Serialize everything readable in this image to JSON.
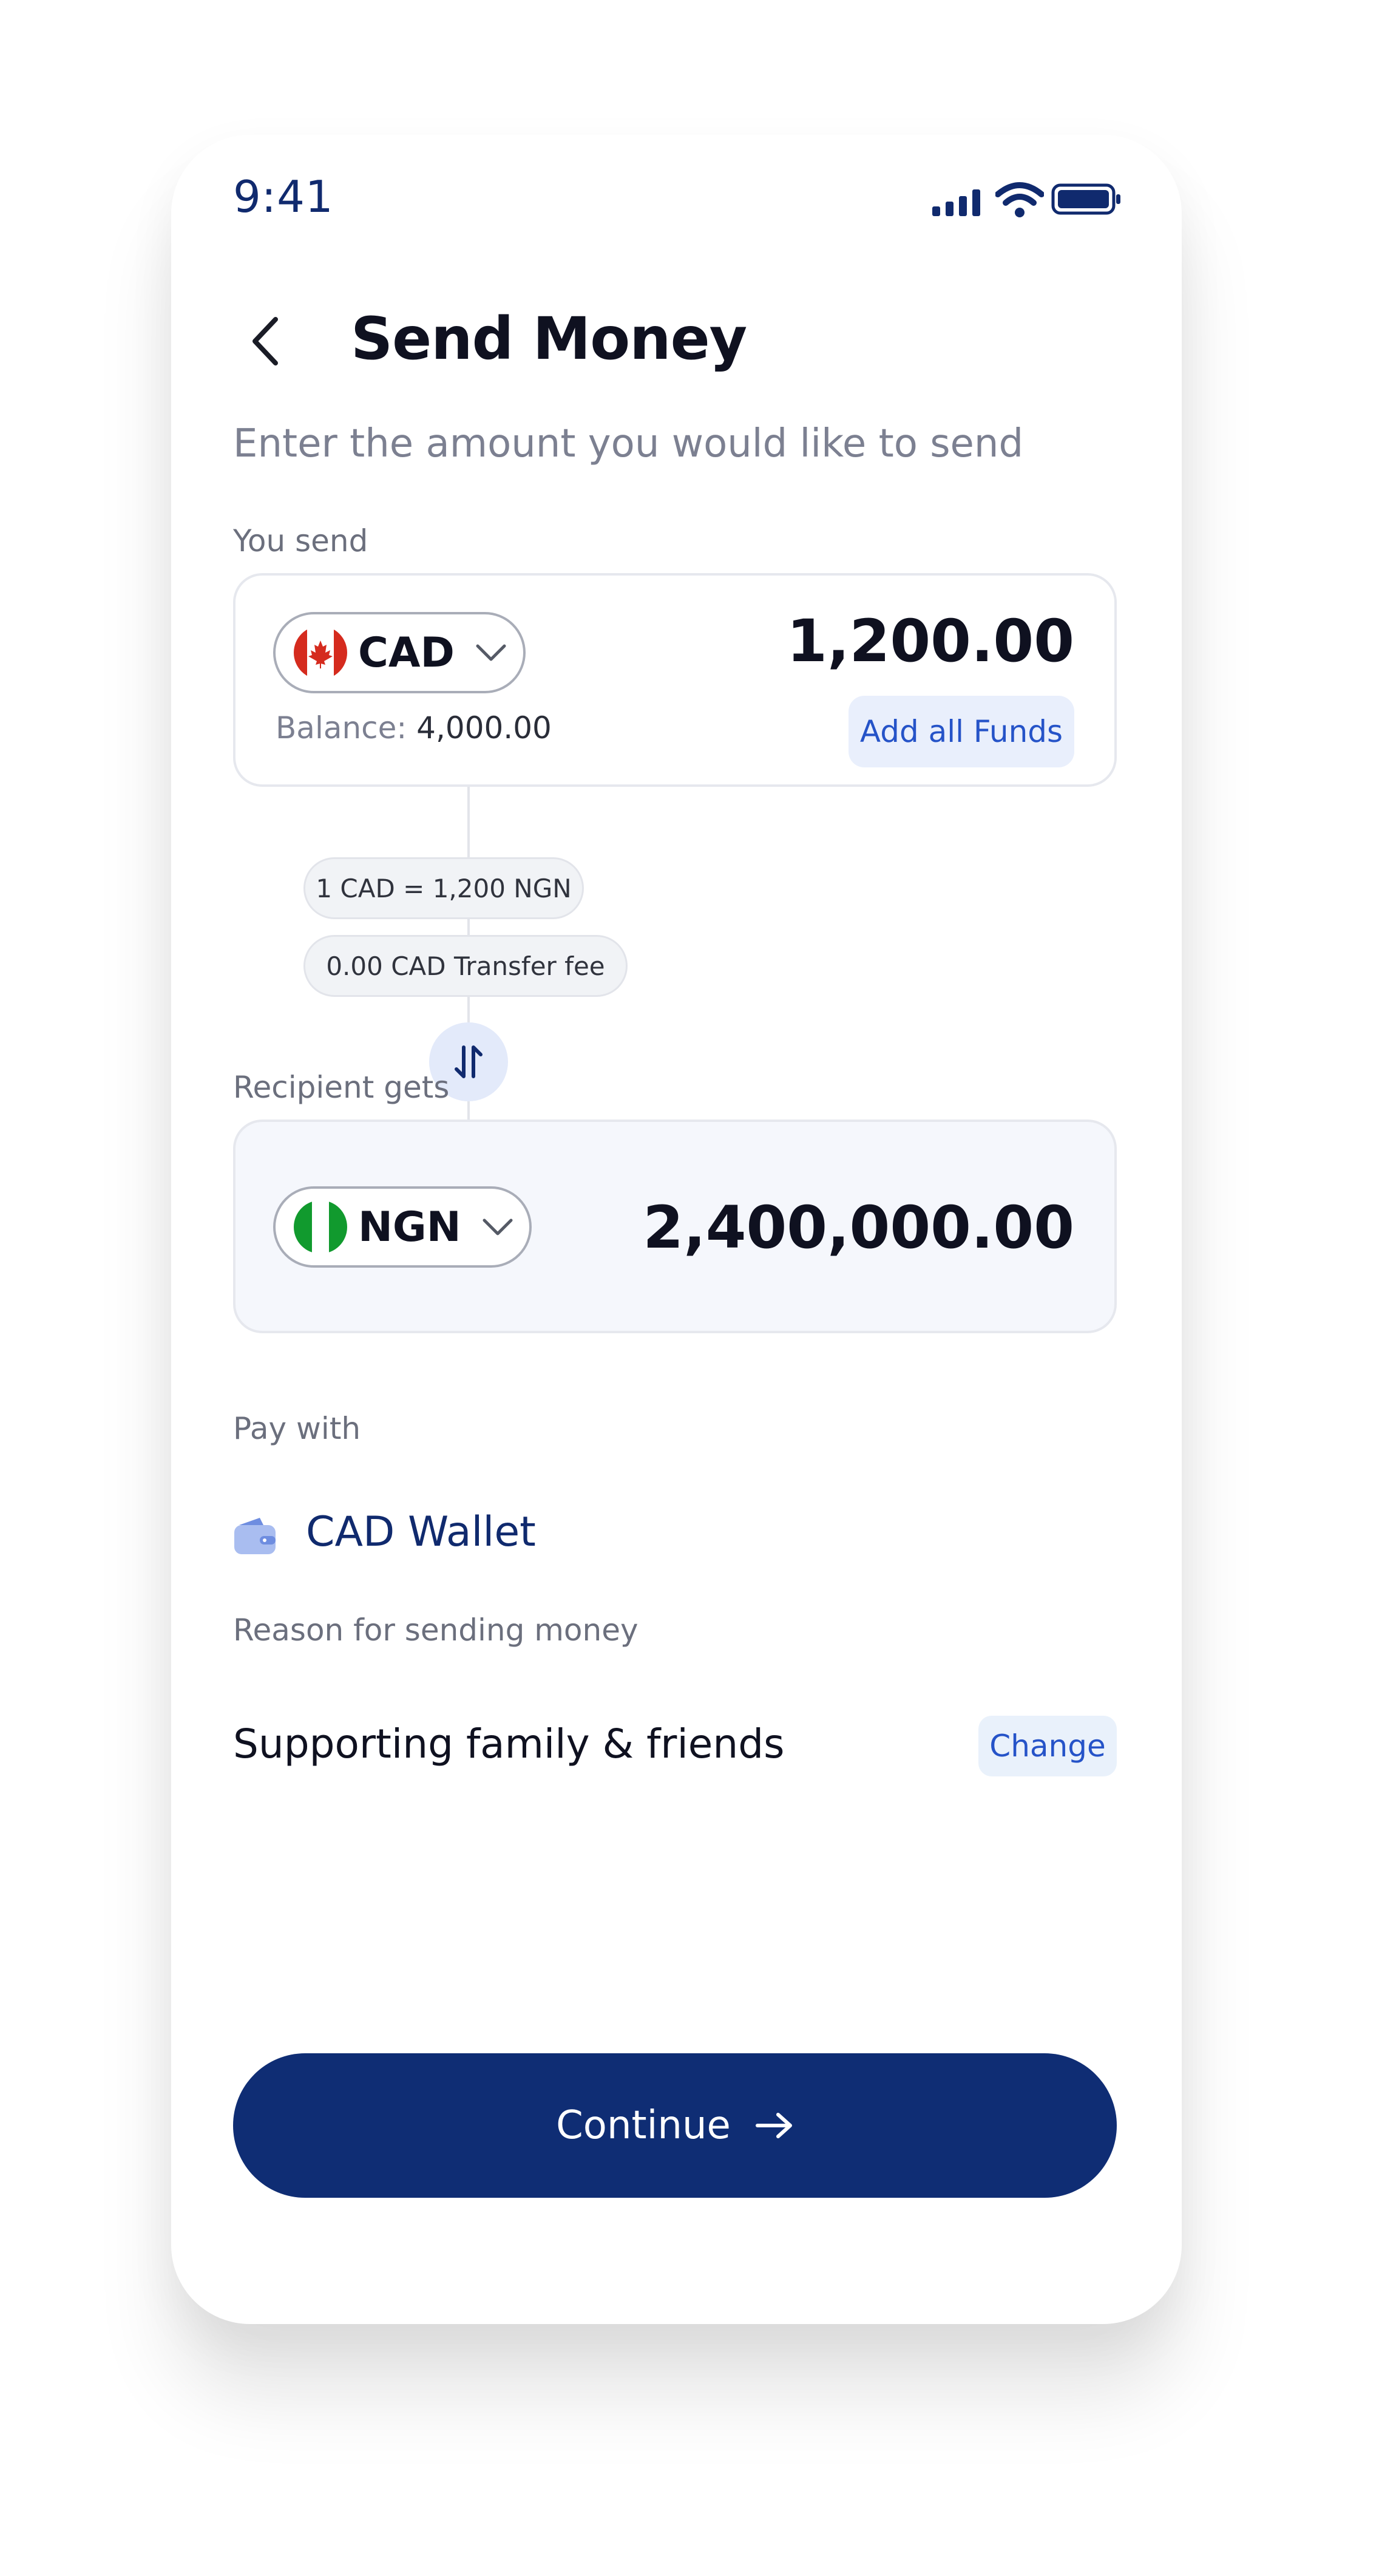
{
  "status_bar": {
    "time": "9:41"
  },
  "header": {
    "title": "Send Money",
    "subtitle": "Enter the amount you would like to send"
  },
  "send": {
    "label": "You send",
    "currency": "CAD",
    "amount": "1,200.00",
    "balance_label": "Balance:",
    "balance_value": "4,000.00",
    "add_funds": "Add all Funds"
  },
  "rates": {
    "exchange": "1 CAD = 1,200 NGN",
    "fee": "0.00 CAD Transfer fee"
  },
  "receive": {
    "label": "Recipient gets",
    "currency": "NGN",
    "amount": "2,400,000.00"
  },
  "pay_with": {
    "label": "Pay with",
    "method": "CAD Wallet",
    "icon": "wallet-icon"
  },
  "reason": {
    "label": "Reason for sending money",
    "value": "Supporting family & friends",
    "change": "Change"
  },
  "continue": {
    "label": "Continue"
  },
  "colors": {
    "primary": "#0f2d74",
    "accent": "#2553c8",
    "text": "#0f1120"
  }
}
